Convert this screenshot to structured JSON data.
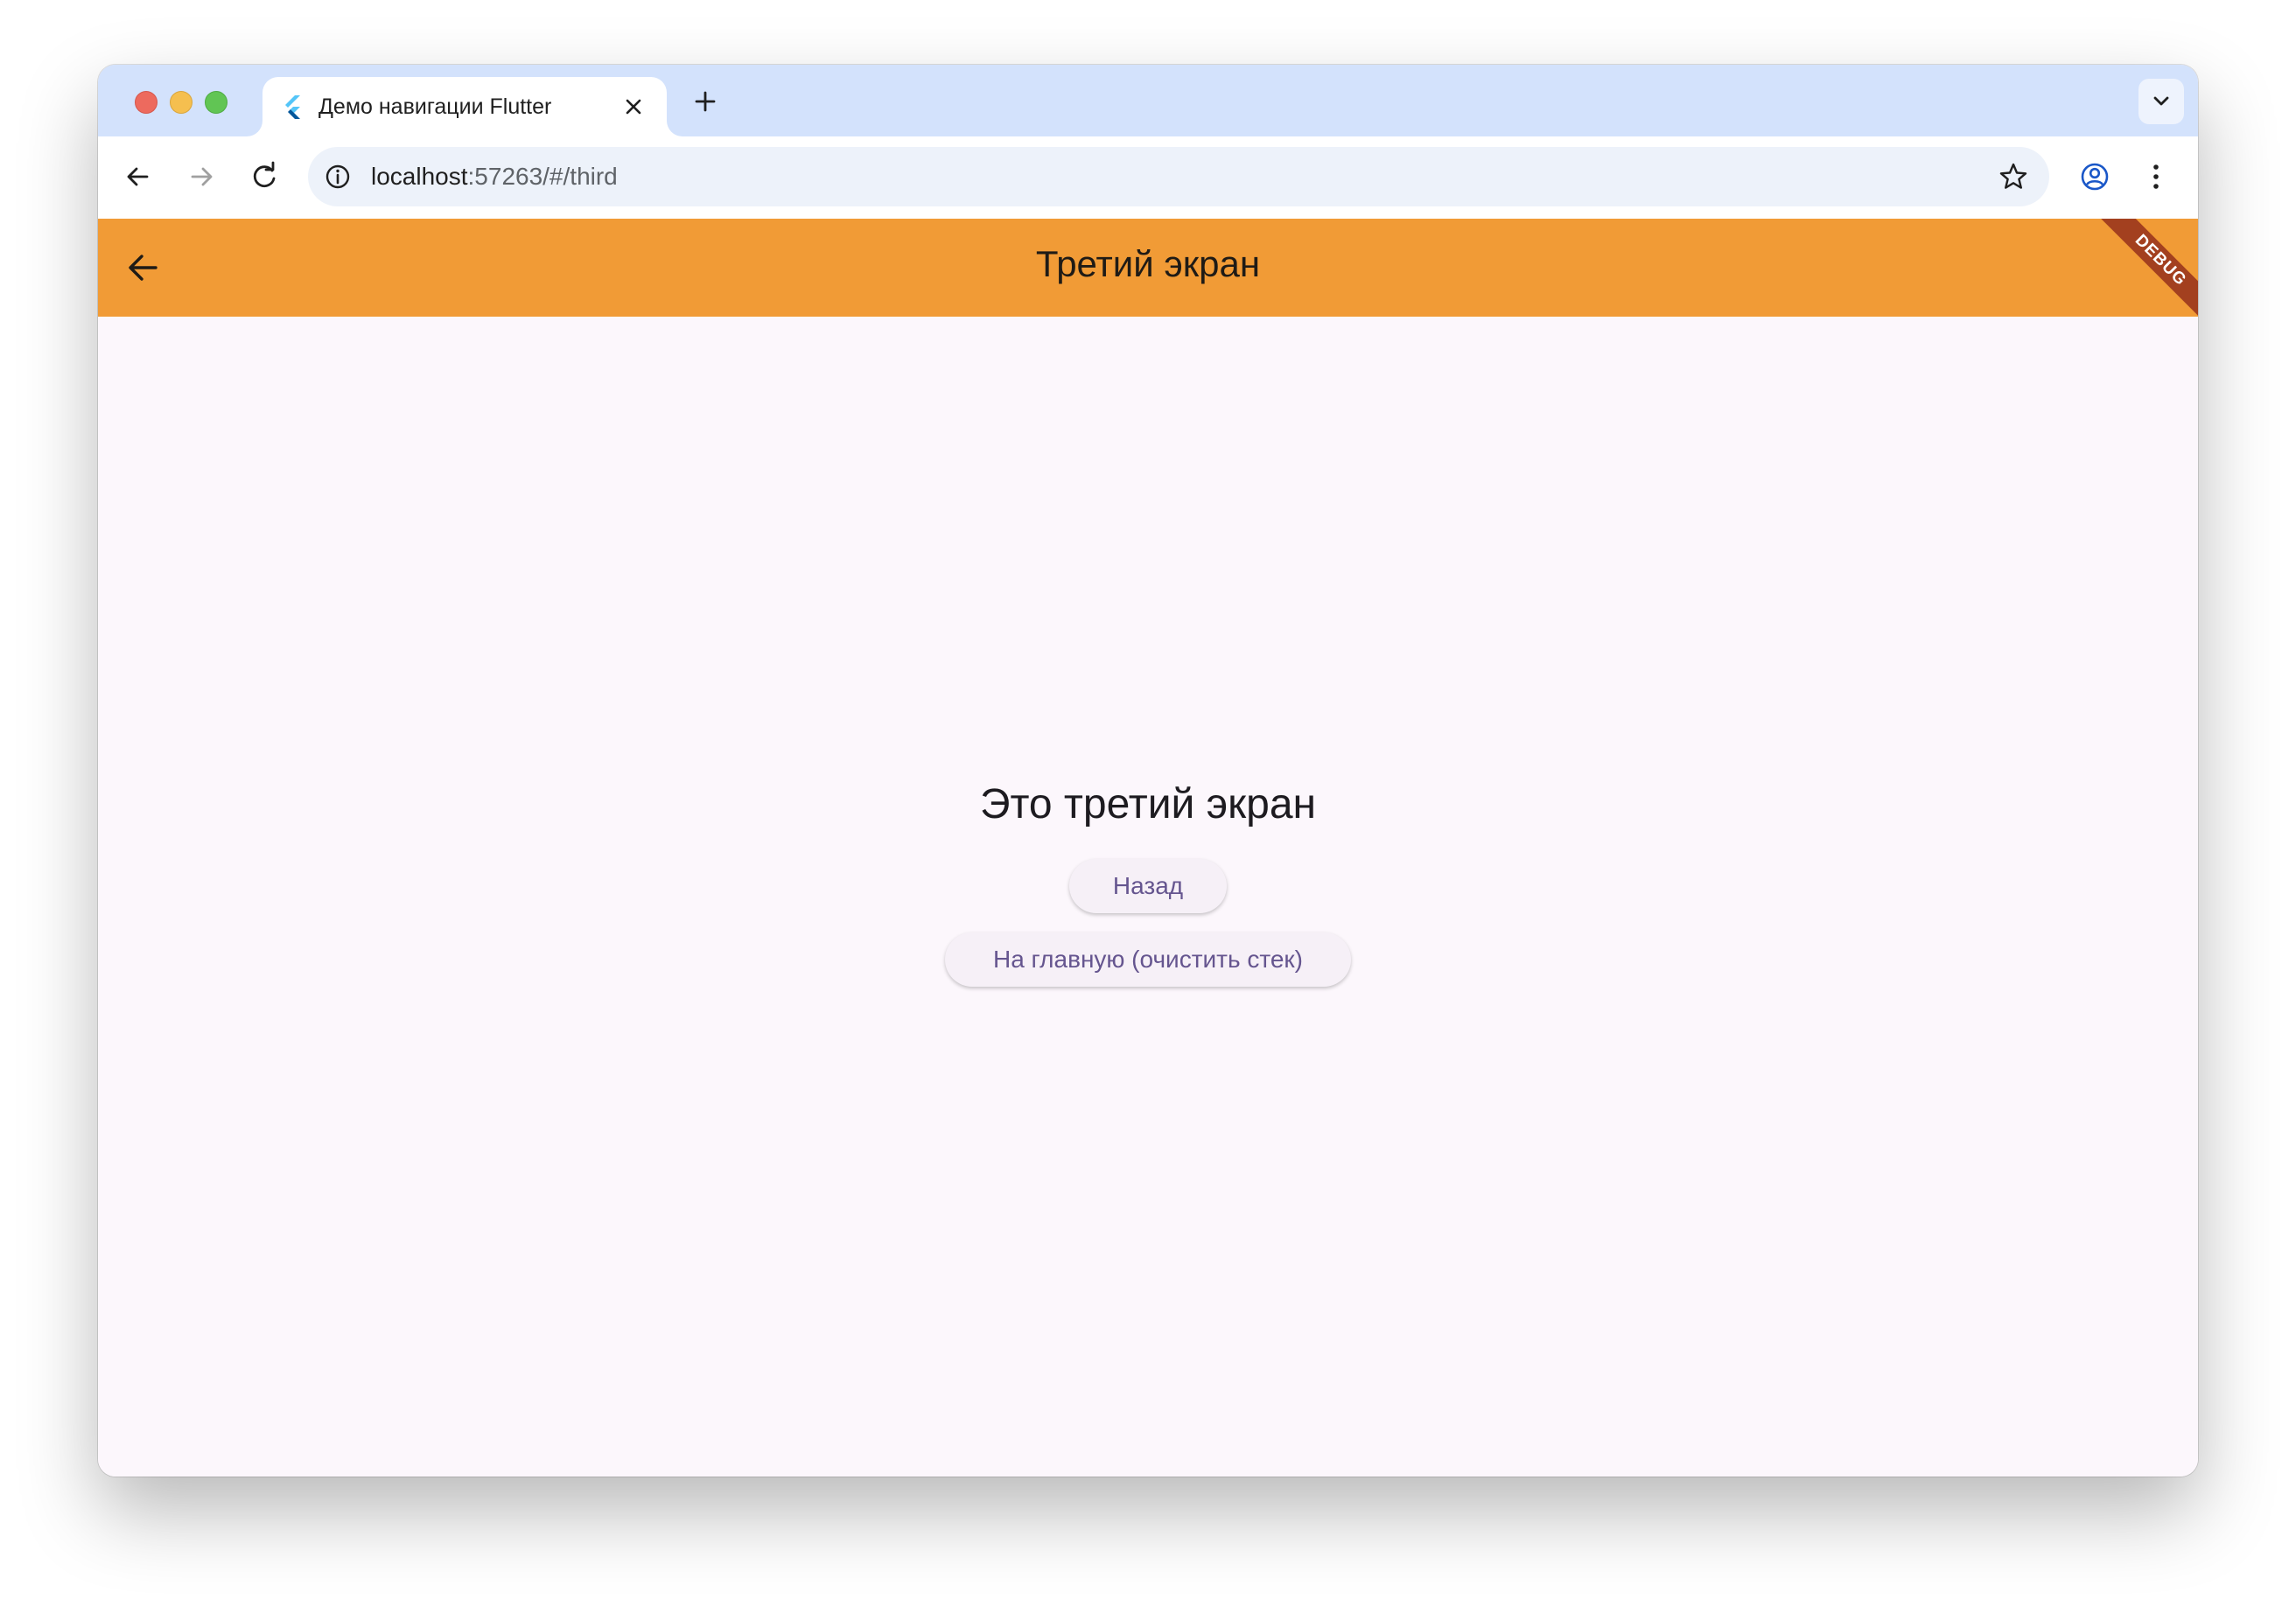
{
  "browser": {
    "tab": {
      "title": "Демо навигации Flutter",
      "favicon": "flutter-logo-icon"
    },
    "address_bar": {
      "host": "localhost",
      "path": ":57263/#/third"
    }
  },
  "app": {
    "appbar": {
      "title": "Третий экран",
      "back_icon": "arrow-back-icon",
      "color": "#f19b36"
    },
    "debug_banner": "DEBUG",
    "main": {
      "heading": "Это третий экран",
      "back_button_label": "Назад",
      "home_button_label": "На главную (очистить стек)"
    }
  },
  "colors": {
    "tabstrip": "#d3e2fc",
    "omnibox": "#edf2fa",
    "background": "#fcf7fc",
    "button_text": "#65558f",
    "debug_banner": "#a3401f"
  }
}
